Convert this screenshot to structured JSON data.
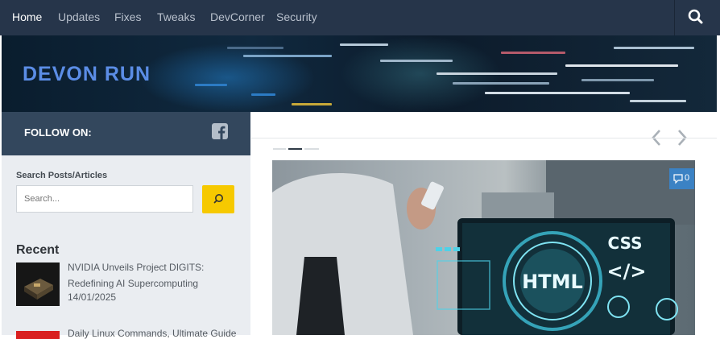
{
  "nav": {
    "items": [
      {
        "label": "Home",
        "active": true
      },
      {
        "label": "Updates"
      },
      {
        "label": "Fixes"
      },
      {
        "label": "Tweaks"
      },
      {
        "label": "DevCorner"
      },
      {
        "label": "Security"
      }
    ],
    "search_icon": "search-icon"
  },
  "banner": {
    "logo_text": "DEVON RUN"
  },
  "sidebar": {
    "follow_label": "FOLLOW ON:",
    "social_icon": "facebook-icon",
    "search_heading": "Search Posts/Articles",
    "search_placeholder": "Search...",
    "recent_heading": "Recent",
    "posts": [
      {
        "title": "NVIDIA Unveils Project DIGITS: Redefining AI Supercomputing",
        "date": "14/01/2025"
      },
      {
        "title": "Daily Linux Commands, Ultimate Guide"
      }
    ]
  },
  "main": {
    "hero_comment_count": "0",
    "hero_image_text": [
      "HTML",
      "CSS",
      "</>"
    ]
  },
  "colors": {
    "nav_bg": "#26354a",
    "follow_bar_bg": "#33475d",
    "search_button": "#f6c900",
    "comment_badge": "#3b82c4",
    "sidebar_bg": "#eaedf1"
  }
}
